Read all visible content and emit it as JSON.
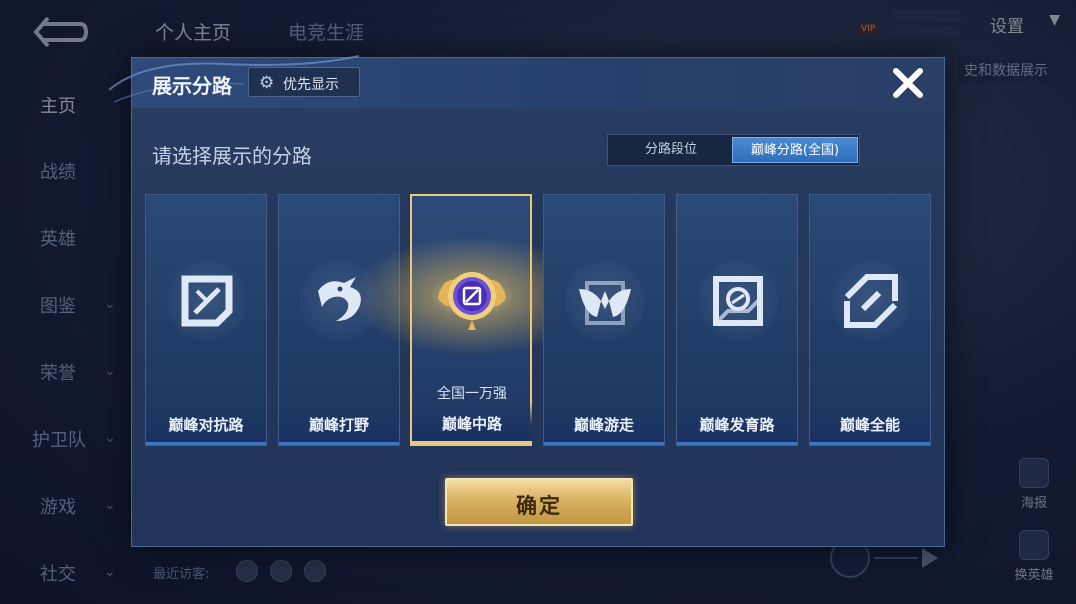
{
  "background": {
    "top_tabs": [
      "个人主页",
      "电竞生涯"
    ],
    "settings_label": "设置",
    "right_button_label": "史和数据展示",
    "vip_label": "VIP",
    "sidebar": [
      {
        "label": "主页",
        "active": true,
        "chevron": false
      },
      {
        "label": "战绩",
        "active": false,
        "chevron": false
      },
      {
        "label": "英雄",
        "active": false,
        "chevron": false
      },
      {
        "label": "图鉴",
        "active": false,
        "chevron": true
      },
      {
        "label": "荣誉",
        "active": false,
        "chevron": true
      },
      {
        "label": "护卫队",
        "active": false,
        "chevron": true
      },
      {
        "label": "游戏",
        "active": false,
        "chevron": true
      },
      {
        "label": "社交",
        "active": false,
        "chevron": true
      }
    ],
    "visitor_label": "最近访客:",
    "right_actions": [
      "海报",
      "换英雄"
    ]
  },
  "modal": {
    "title": "展示分路",
    "priority_label": "优先显示",
    "priority_icon": "gear-icon",
    "close_icon": "close-icon",
    "subtitle": "请选择展示的分路",
    "segments": [
      {
        "label": "分路段位",
        "active": false
      },
      {
        "label": "巅峰分路(全国)",
        "active": true
      }
    ],
    "cards": [
      {
        "label": "巅峰对抗路",
        "icon": "sword-icon",
        "selected": false,
        "rank": ""
      },
      {
        "label": "巅峰打野",
        "icon": "dragon-icon",
        "selected": false,
        "rank": ""
      },
      {
        "label": "巅峰中路",
        "icon": "mid-lane-badge-icon",
        "selected": true,
        "rank": "全国一万强"
      },
      {
        "label": "巅峰游走",
        "icon": "wings-icon",
        "selected": false,
        "rank": ""
      },
      {
        "label": "巅峰发育路",
        "icon": "marksman-icon",
        "selected": false,
        "rank": ""
      },
      {
        "label": "巅峰全能",
        "icon": "all-round-icon",
        "selected": false,
        "rank": ""
      }
    ],
    "confirm_label": "确定",
    "colors": {
      "gold": "#e9c87a",
      "active_tab": "#3a7cc8",
      "panel": "#243759"
    }
  }
}
